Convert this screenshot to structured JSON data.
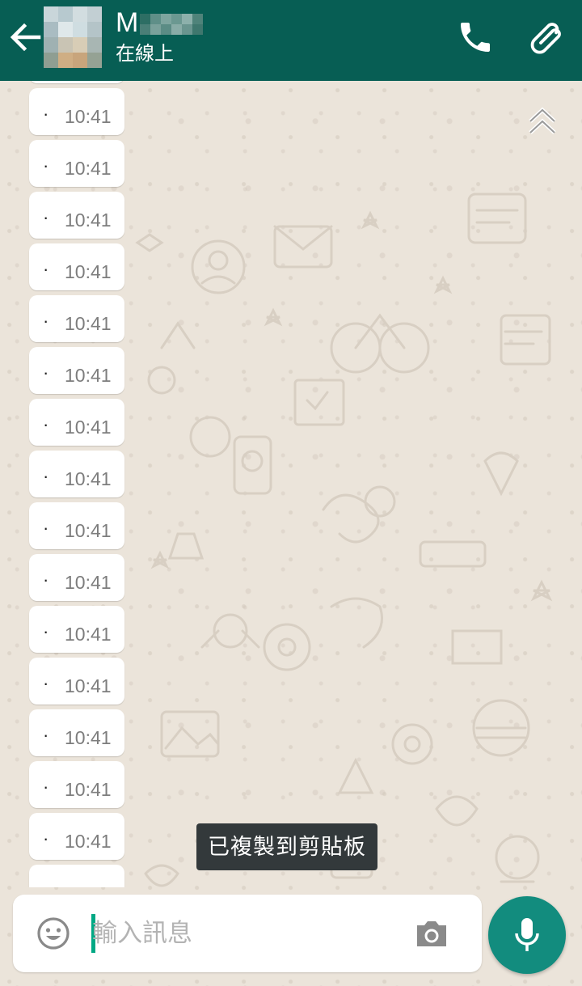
{
  "header": {
    "contact_name": "M",
    "status": "在線上",
    "background": "#075e54"
  },
  "icons": {
    "back": "arrow-left-icon",
    "call": "phone-icon",
    "attach": "paperclip-icon",
    "scroll_up": "double-chevron-up-icon",
    "emoji": "smiley-icon",
    "camera": "camera-icon",
    "mic": "microphone-icon"
  },
  "messages": [
    {
      "bullet": "·",
      "time": "10:41"
    },
    {
      "bullet": "·",
      "time": "10:41"
    },
    {
      "bullet": "·",
      "time": "10:41"
    },
    {
      "bullet": "·",
      "time": "10:41"
    },
    {
      "bullet": "·",
      "time": "10:41"
    },
    {
      "bullet": "·",
      "time": "10:41"
    },
    {
      "bullet": "·",
      "time": "10:41"
    },
    {
      "bullet": "·",
      "time": "10:41"
    },
    {
      "bullet": "·",
      "time": "10:41"
    },
    {
      "bullet": "·",
      "time": "10:41"
    },
    {
      "bullet": "·",
      "time": "10:41"
    },
    {
      "bullet": "·",
      "time": "10:41"
    },
    {
      "bullet": "·",
      "time": "10:41"
    },
    {
      "bullet": "·",
      "time": "10:41"
    },
    {
      "bullet": "·",
      "time": "10:41"
    }
  ],
  "toast": {
    "text": "已複製到剪貼板"
  },
  "composer": {
    "placeholder": "輸入訊息",
    "value": ""
  },
  "colors": {
    "accent": "#128c7e",
    "cursor": "#00a884",
    "wallpaper": "#ebe4da"
  }
}
